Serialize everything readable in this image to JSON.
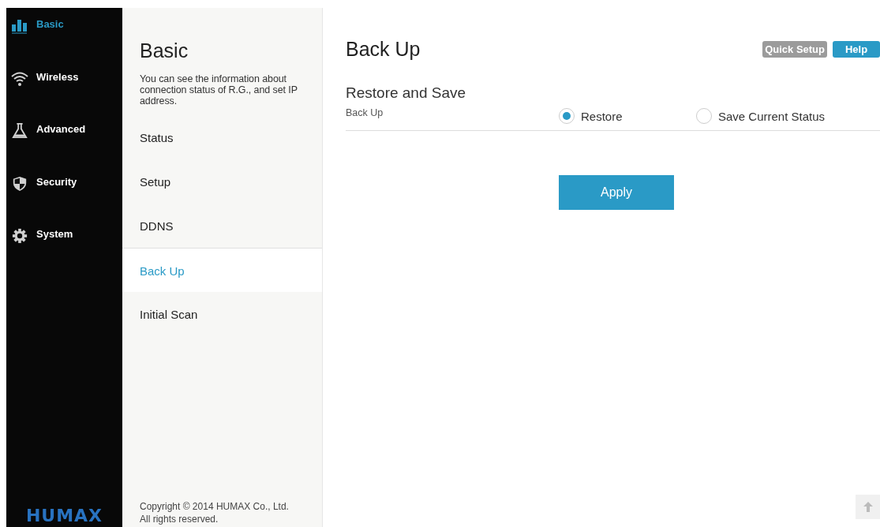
{
  "nav": {
    "items": [
      {
        "label": "Basic",
        "kind": "chart",
        "selected": true
      },
      {
        "label": "Wireless",
        "kind": "wifi",
        "selected": false
      },
      {
        "label": "Advanced",
        "kind": "flask",
        "selected": false
      },
      {
        "label": "Security",
        "kind": "shield",
        "selected": false
      },
      {
        "label": "System",
        "kind": "gear",
        "selected": false
      }
    ],
    "logo": "HUMAX"
  },
  "submenu": {
    "title": "Basic",
    "description": "You can see the information about connection status of R.G., and set IP address.",
    "items": [
      {
        "label": "Status",
        "selected": false
      },
      {
        "label": "Setup",
        "selected": false
      },
      {
        "label": "DDNS",
        "selected": false
      },
      {
        "label": "Back Up",
        "selected": true
      },
      {
        "label": "Initial Scan",
        "selected": false
      }
    ],
    "copyright": [
      "Copyright © 2014 HUMAX Co., Ltd.",
      "All rights reserved."
    ]
  },
  "main": {
    "title": "Back Up",
    "buttons": [
      {
        "label": "Quick Setup",
        "kind": "secondary"
      },
      {
        "label": "Help",
        "kind": "primary"
      }
    ],
    "section": "Restore and Save",
    "field_label": "Back Up",
    "options": [
      {
        "label": "Restore",
        "selected": true
      },
      {
        "label": "Save Current Status",
        "selected": false
      }
    ],
    "apply": "Apply"
  }
}
